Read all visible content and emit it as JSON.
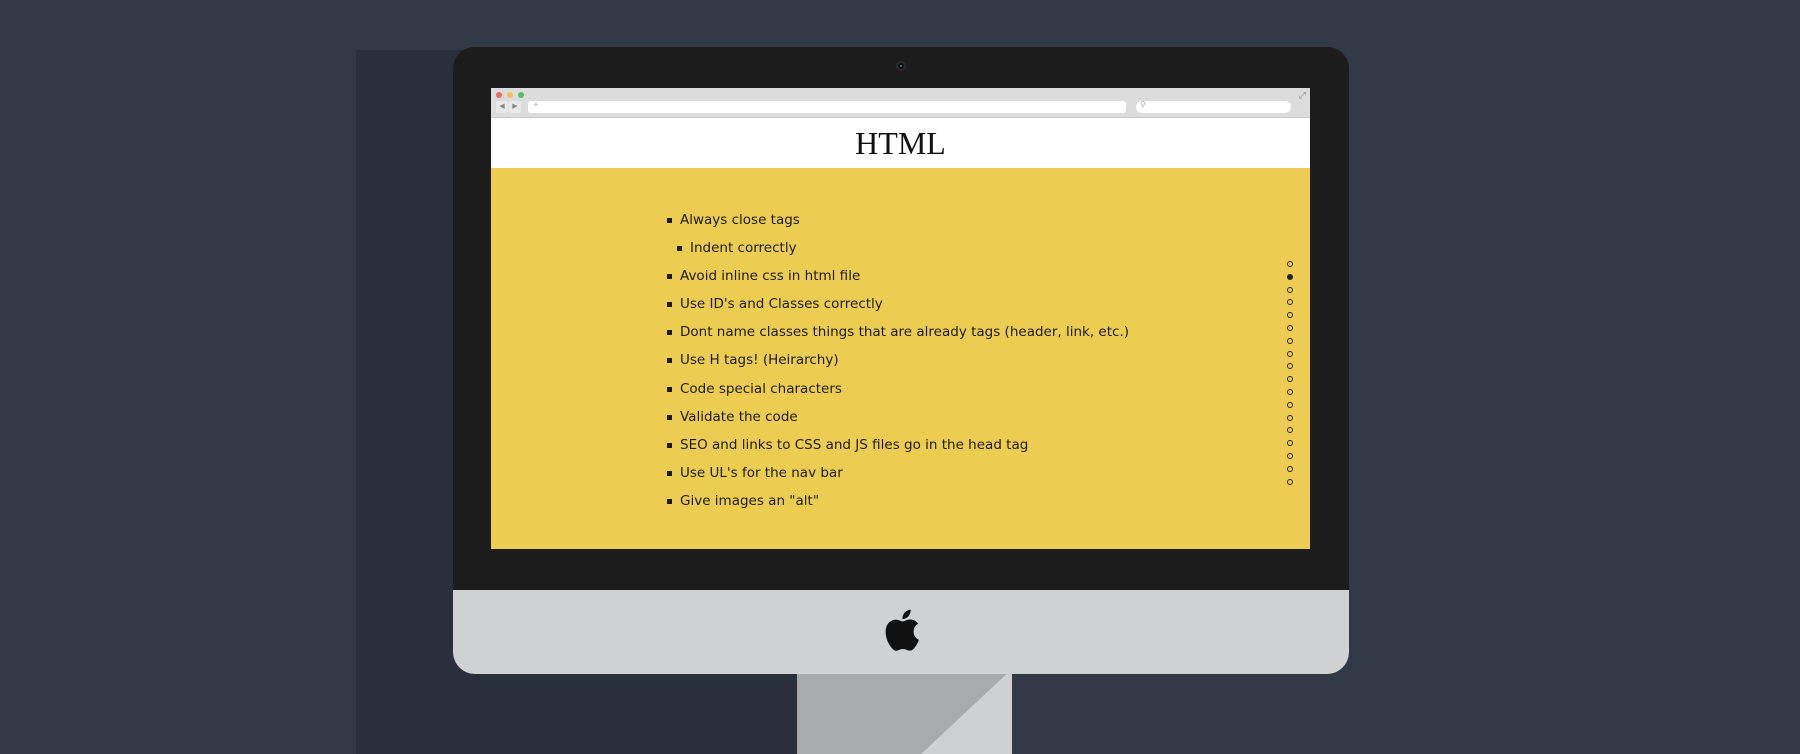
{
  "page": {
    "title": "HTML",
    "tips": [
      {
        "text": "Always close tags",
        "indent": false
      },
      {
        "text": "Indent correctly",
        "indent": true
      },
      {
        "text": "Avoid inline css in html file",
        "indent": false
      },
      {
        "text": "Use ID's and Classes correctly",
        "indent": false
      },
      {
        "text": "Dont name classes things that are already tags (header, link, etc.)",
        "indent": false
      },
      {
        "text": "Use H tags! (Heirarchy)",
        "indent": false
      },
      {
        "text": "Code special characters",
        "indent": false
      },
      {
        "text": "Validate the code",
        "indent": false
      },
      {
        "text": "SEO and links to CSS and JS files go in the head tag",
        "indent": false
      },
      {
        "text": "Use UL's for the nav bar",
        "indent": false
      },
      {
        "text": "Give images an \"alt\"",
        "indent": false
      }
    ]
  },
  "pager": {
    "total": 18,
    "active_index": 1
  },
  "browser": {
    "back_glyph": "◀",
    "forward_glyph": "▶",
    "new_tab_glyph": "+",
    "search_glyph": "⚲",
    "expand_glyph": "⤢"
  },
  "colors": {
    "background": "#323946",
    "slide_background": "#eccd52",
    "header_background": "#ffffff",
    "monitor_bezel": "#1c1c1c",
    "monitor_chin": "#d0d1d3"
  }
}
